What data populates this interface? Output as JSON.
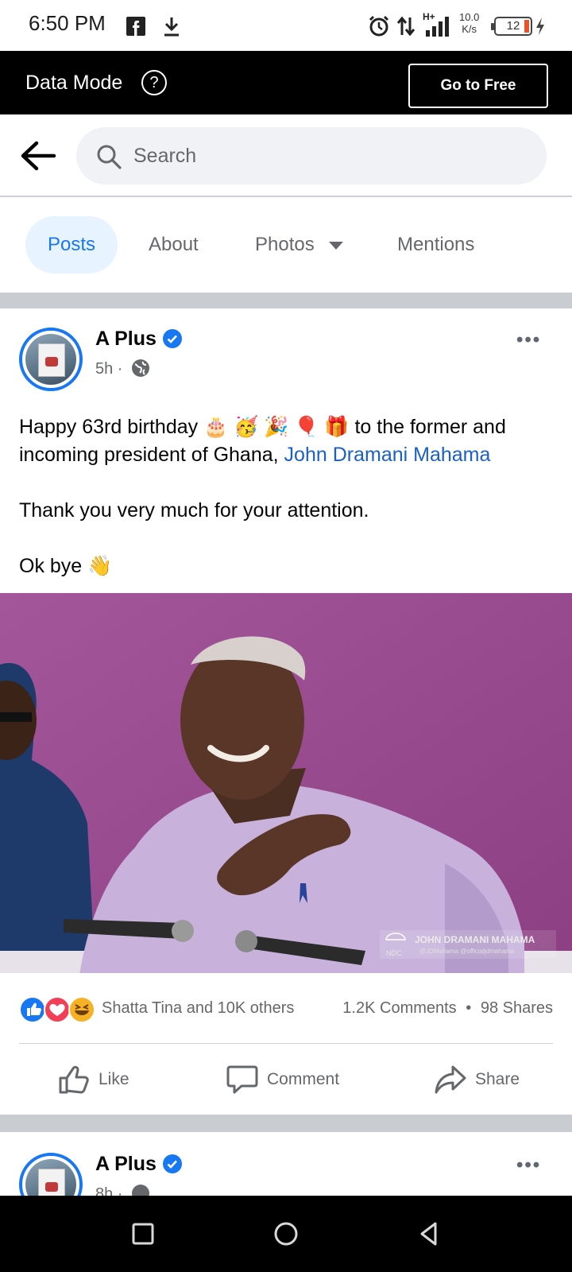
{
  "status_bar": {
    "time": "6:50 PM",
    "network": "H+",
    "speed_value": "10.0",
    "speed_unit": "K/s",
    "battery": "12",
    "icons": [
      "facebook-icon",
      "download-icon",
      "alarm-icon",
      "data-arrows-icon",
      "signal-icon",
      "battery-icon",
      "charging-icon"
    ]
  },
  "data_mode": {
    "label": "Data Mode",
    "help": "?",
    "button": "Go to Free"
  },
  "search": {
    "placeholder": "Search"
  },
  "tabs": [
    {
      "label": "Posts",
      "active": true
    },
    {
      "label": "About"
    },
    {
      "label": "Photos"
    },
    {
      "label": "Mentions"
    }
  ],
  "post": {
    "author": "A Plus",
    "time": "5h",
    "text_line1_a": "Happy 63rd birthday ",
    "text_line1_emoji": "🎂 🥳 🎉 🎈 🎁",
    "text_line1_b": " to the former and",
    "text_line2_a": "incoming president of Ghana, ",
    "mention": "John Dramani Mahama",
    "text_para2": "Thank you very much for your attention.",
    "text_para3": "Ok bye 👋",
    "watermark_title": "JOHN DRAMANI MAHAMA",
    "watermark_sub": "@JDMahama @officialjdmahama",
    "watermark_logo": "NDC",
    "reactions_text": "Shatta Tina and 10K others",
    "comments": "1.2K Comments",
    "dot": "•",
    "shares": "98 Shares",
    "actions": {
      "like": "Like",
      "comment": "Comment",
      "share": "Share"
    }
  },
  "next_post": {
    "author": "A Plus",
    "time": "8h"
  },
  "colors": {
    "accent": "#1877f2",
    "active_tab_bg": "#e7f3ff",
    "secondary_text": "#65676b",
    "separator": "#c9ccd1",
    "link": "#1a5fc7"
  }
}
